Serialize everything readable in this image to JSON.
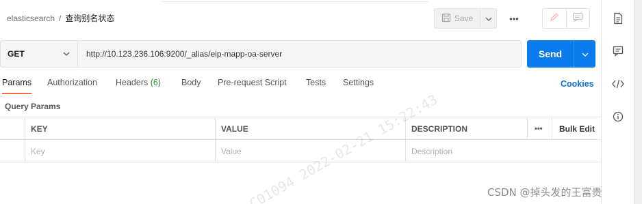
{
  "header": {
    "breadcrumb_parent": "elasticsearch",
    "breadcrumb_separator": "/",
    "request_name": "查询别名状态",
    "save_label": "Save",
    "more_label": "•••"
  },
  "request": {
    "method": "GET",
    "url": "http://10.123.236.106:9200/_alias/eip-mapp-oa-server",
    "send_label": "Send"
  },
  "tabs": [
    {
      "label": "Params",
      "active": true
    },
    {
      "label": "Authorization"
    },
    {
      "label": "Headers",
      "count": "(6)"
    },
    {
      "label": "Body"
    },
    {
      "label": "Pre-request Script"
    },
    {
      "label": "Tests"
    },
    {
      "label": "Settings"
    }
  ],
  "cookies_label": "Cookies",
  "query_params": {
    "title": "Query Params",
    "columns": [
      "KEY",
      "VALUE",
      "DESCRIPTION"
    ],
    "more_label": "•••",
    "bulk_edit_label": "Bulk Edit",
    "placeholders": [
      "Key",
      "Value",
      "Description"
    ]
  },
  "watermark": "C01094  2022-02-21  15:22:43",
  "footer_mark": "CSDN @掉头发的王富贵",
  "colors": {
    "accent": "#097bed",
    "active_tab": "#f26b3a",
    "headers_count": "#2f8c3a",
    "cookies": "#0b6fd6"
  },
  "icons": {
    "save": "save-icon",
    "edit": "pencil-icon",
    "comment": "comment-icon",
    "docs": "document-icon",
    "comments_panel": "comments-icon",
    "code": "code-icon",
    "info": "info-icon"
  }
}
